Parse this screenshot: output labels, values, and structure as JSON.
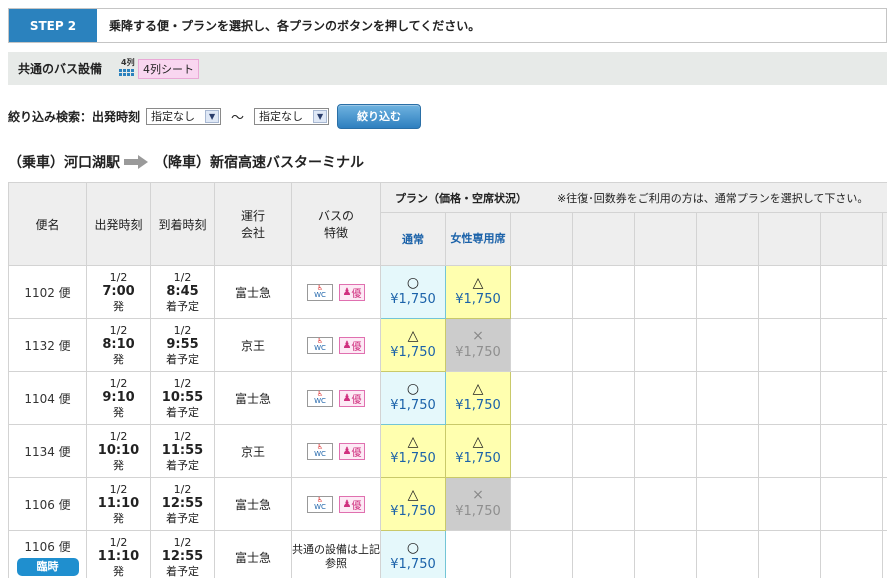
{
  "step": {
    "label": "STEP 2",
    "text": "乗降する便・プランを選択し、各プランのボタンを押してください。"
  },
  "equipment": {
    "title": "共通のバス設備",
    "seat_icon_num": "4列",
    "seat_tag": "4列シート"
  },
  "filter": {
    "label": "絞り込み検索：出発時刻",
    "from_value": "指定なし",
    "tilde": "〜",
    "to_value": "指定なし",
    "button": "絞り込む"
  },
  "route": {
    "board": "（乗車）河口湖駅",
    "alight": "（降車）新宿高速バスターミナル"
  },
  "table": {
    "headers": {
      "bin": "便名",
      "depart": "出発時刻",
      "arrive": "到着時刻",
      "company": "運行\n会社",
      "features": "バスの\n特徴",
      "plan": "プラン（価格・空席状況）",
      "plan_note": "※往復･回数券をご利用の方は、通常プランを選択して下さい。",
      "normal": "通常",
      "female": "女性専用席"
    },
    "rows": [
      {
        "bin": "1102 便",
        "d_date": "1/2",
        "d_time": "7:00",
        "d_suffix": "発",
        "a_date": "1/2",
        "a_time": "8:45",
        "a_suffix": "着予定",
        "company": "富士急",
        "features": "icons",
        "normal": {
          "mark": "○",
          "price": "¥1,750",
          "style": "cyan"
        },
        "female": {
          "mark": "△",
          "price": "¥1,750",
          "style": "yellow"
        }
      },
      {
        "bin": "1132 便",
        "d_date": "1/2",
        "d_time": "8:10",
        "d_suffix": "発",
        "a_date": "1/2",
        "a_time": "9:55",
        "a_suffix": "着予定",
        "company": "京王",
        "features": "icons",
        "normal": {
          "mark": "△",
          "price": "¥1,750",
          "style": "yellow"
        },
        "female": {
          "mark": "×",
          "price": "¥1,750",
          "style": "gray"
        }
      },
      {
        "bin": "1104 便",
        "d_date": "1/2",
        "d_time": "9:10",
        "d_suffix": "発",
        "a_date": "1/2",
        "a_time": "10:55",
        "a_suffix": "着予定",
        "company": "富士急",
        "features": "icons",
        "normal": {
          "mark": "○",
          "price": "¥1,750",
          "style": "cyan"
        },
        "female": {
          "mark": "△",
          "price": "¥1,750",
          "style": "yellow"
        }
      },
      {
        "bin": "1134 便",
        "d_date": "1/2",
        "d_time": "10:10",
        "d_suffix": "発",
        "a_date": "1/2",
        "a_time": "11:55",
        "a_suffix": "着予定",
        "company": "京王",
        "features": "icons",
        "normal": {
          "mark": "△",
          "price": "¥1,750",
          "style": "yellow"
        },
        "female": {
          "mark": "△",
          "price": "¥1,750",
          "style": "yellow"
        }
      },
      {
        "bin": "1106 便",
        "d_date": "1/2",
        "d_time": "11:10",
        "d_suffix": "発",
        "a_date": "1/2",
        "a_time": "12:55",
        "a_suffix": "着予定",
        "company": "富士急",
        "features": "icons",
        "normal": {
          "mark": "△",
          "price": "¥1,750",
          "style": "yellow"
        },
        "female": {
          "mark": "×",
          "price": "¥1,750",
          "style": "gray"
        }
      },
      {
        "bin": "1106 便",
        "badge": "臨時",
        "d_date": "1/2",
        "d_time": "11:10",
        "d_suffix": "発",
        "a_date": "1/2",
        "a_time": "12:55",
        "a_suffix": "着予定",
        "company": "富士急",
        "features": "共通の設備は上記参照",
        "normal": {
          "mark": "○",
          "price": "¥1,750",
          "style": "cyan"
        },
        "female": null
      }
    ]
  },
  "icons": {
    "wc_top": "♿",
    "wc_bottom": "WC",
    "priority": "優"
  }
}
